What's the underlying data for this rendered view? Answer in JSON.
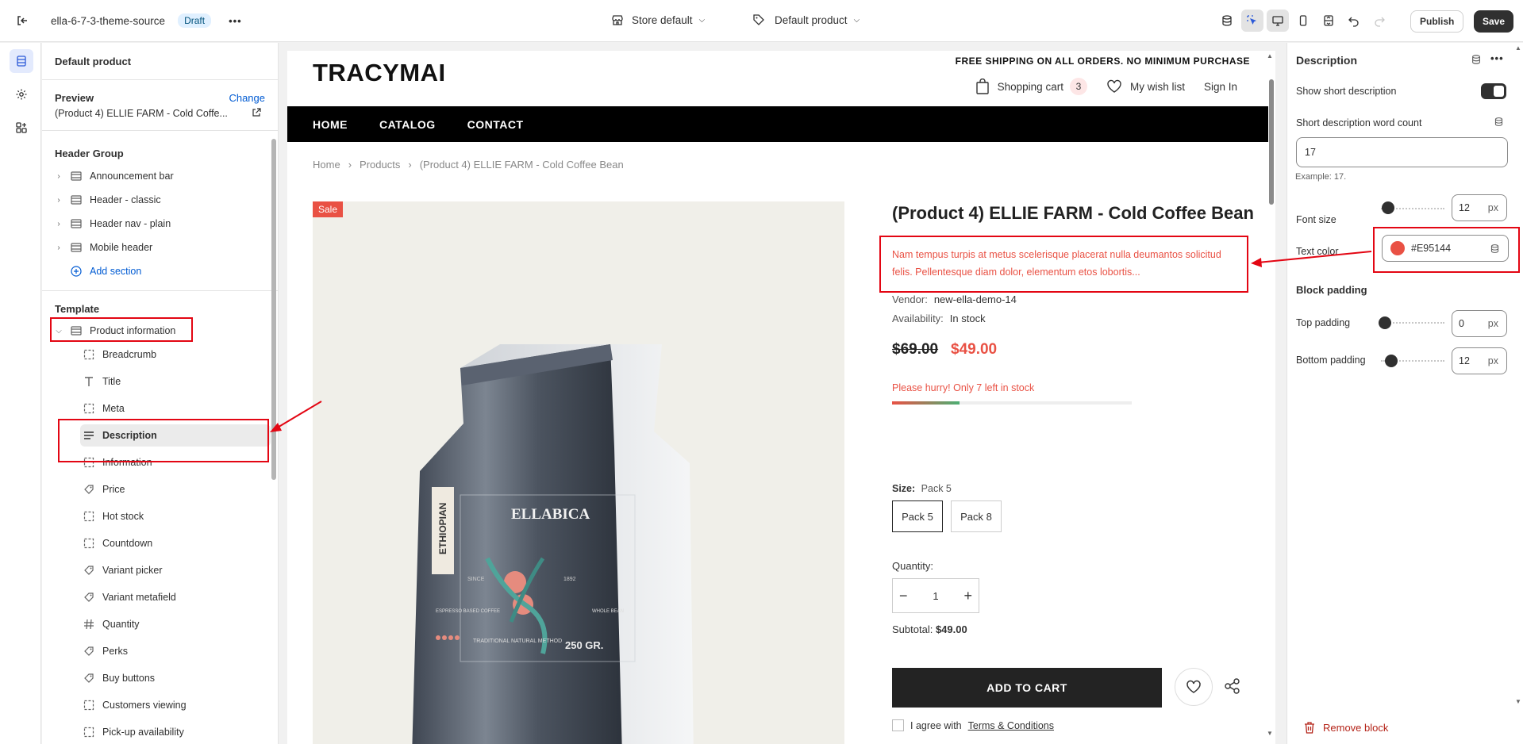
{
  "topbar": {
    "theme_name": "ella-6-7-3-theme-source",
    "draft_badge": "Draft",
    "store_select": "Store default",
    "template_select": "Default product",
    "publish_label": "Publish",
    "save_label": "Save"
  },
  "left_panel": {
    "title": "Default product",
    "preview_label": "Preview",
    "change_link": "Change",
    "preview_product": "(Product 4) ELLIE FARM - Cold Coffe...",
    "header_group_title": "Header Group",
    "header_items": [
      "Announcement bar",
      "Header - classic",
      "Header nav - plain",
      "Mobile header"
    ],
    "add_section": "Add section",
    "template_title": "Template",
    "product_information": "Product information",
    "blocks": [
      "Breadcrumb",
      "Title",
      "Meta",
      "Description",
      "Information",
      "Price",
      "Hot stock",
      "Countdown",
      "Variant picker",
      "Variant metafield",
      "Quantity",
      "Perks",
      "Buy buttons",
      "Customers viewing",
      "Pick-up availability"
    ]
  },
  "store": {
    "free_shipping": "FREE SHIPPING ON ALL ORDERS. NO MINIMUM PURCHASE",
    "logo": "TRACYMAI",
    "shopping_cart": "Shopping cart",
    "cart_count": "3",
    "wishlist": "My wish list",
    "sign_in": "Sign In",
    "nav": [
      "HOME",
      "CATALOG",
      "CONTACT"
    ],
    "breadcrumbs": [
      "Home",
      "Products",
      "(Product 4) ELLIE FARM - Cold Coffee Bean"
    ],
    "sale_badge": "Sale",
    "product_title": "(Product 4) ELLIE FARM - Cold Coffee Bean",
    "description": "Nam tempus turpis at metus scelerisque placerat nulla deumantos solicitud felis. Pellentesque diam dolor, elementum etos lobortis...",
    "vendor_label": "Vendor:",
    "vendor_value": "new-ella-demo-14",
    "availability_label": "Availability:",
    "availability_value": "In stock",
    "price_old": "$69.00",
    "price_new": "$49.00",
    "hurry_text": "Please hurry! Only 7 left in stock",
    "stock_level_fraction": 0.28,
    "size_label": "Size:",
    "size_value": "Pack 5",
    "sizes": [
      "Pack 5",
      "Pack 8"
    ],
    "quantity_label": "Quantity:",
    "quantity_value": "1",
    "subtotal_label": "Subtotal:",
    "subtotal_value": "$49.00",
    "add_to_cart": "ADD TO CART",
    "agree_text": "I agree with",
    "terms_link": "Terms & Conditions",
    "bag": {
      "brand": "ELLABICA",
      "origin": "ETHIOPIAN",
      "since": "SINCE",
      "year": "1892",
      "left_label": "ESPRESSO BASED COFFEE",
      "right_label": "WHOLE BEAN",
      "method": "TRADITIONAL NATURAL METHOD",
      "weight": "250 GR."
    }
  },
  "right_panel": {
    "title": "Description",
    "show_short_desc": "Show short description",
    "word_count_label": "Short description word count",
    "word_count_value": "17",
    "example_hint": "Example: 17.",
    "font_size_label": "Font size",
    "font_size_value": "12",
    "unit": "px",
    "text_color_label": "Text color",
    "text_color_value": "#E95144",
    "block_padding": "Block padding",
    "top_padding_label": "Top padding",
    "top_padding_value": "0",
    "bottom_padding_label": "Bottom padding",
    "bottom_padding_value": "12",
    "remove_block": "Remove block"
  },
  "colors": {
    "accent_red": "#E95144",
    "annotation_red": "#E30613",
    "dark": "#303030"
  }
}
